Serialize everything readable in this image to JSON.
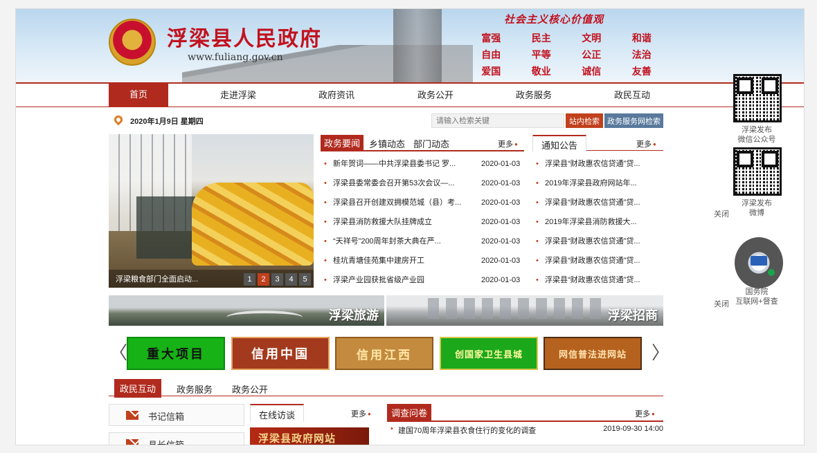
{
  "header": {
    "site_title": "浮梁县人民政府",
    "site_url": "www.fuliang.gov.cn",
    "values_title": "社会主义核心价值观",
    "values": [
      "富强",
      "民主",
      "文明",
      "和谐",
      "自由",
      "平等",
      "公正",
      "法治",
      "爱国",
      "敬业",
      "诚信",
      "友善"
    ]
  },
  "nav": {
    "items": [
      "首页",
      "走进浮梁",
      "政府资讯",
      "政务公开",
      "政务服务",
      "政民互动"
    ],
    "active": "首页"
  },
  "toolbar": {
    "date": "2020年1月9日 星期四",
    "search_placeholder": "请输入检索关键",
    "site_search_label": "站内检索",
    "gov_search_label": "政务服务网检索"
  },
  "slideshow": {
    "caption": "浮梁粮食部门全面启动...",
    "pages": [
      "1",
      "2",
      "3",
      "4",
      "5"
    ],
    "active_page": "2"
  },
  "news": {
    "tabs": [
      "政务要闻",
      "乡镇动态",
      "部门动态"
    ],
    "active_tab": "政务要闻",
    "more": "更多",
    "items": [
      {
        "title": "新年贺词——中共浮梁县委书记 罗...",
        "date": "2020-01-03"
      },
      {
        "title": "浮梁县委常委会召开第53次会议—...",
        "date": "2020-01-03"
      },
      {
        "title": "浮梁县召开创建双拥模范城（县）考...",
        "date": "2020-01-03"
      },
      {
        "title": "浮梁县消防救援大队挂牌成立",
        "date": "2020-01-03"
      },
      {
        "title": "“天祥号”200周年封茶大典在严...",
        "date": "2020-01-03"
      },
      {
        "title": "桂坑青塘佳苑集中建房开工",
        "date": "2020-01-03"
      },
      {
        "title": "浮梁产业园获批省级产业园",
        "date": "2020-01-03"
      }
    ]
  },
  "notice": {
    "tab": "通知公告",
    "more": "更多",
    "items": [
      "浮梁县“财政惠农信贷通”贷...",
      "2019年浮梁县政府网站年...",
      "浮梁县“财政惠农信贷通”贷...",
      "2019年浮梁县消防救援大...",
      "浮梁县“财政惠农信贷通”贷...",
      "浮梁县“财政惠农信贷通”贷...",
      "浮梁县“财政惠农信贷通”贷..."
    ]
  },
  "promos": {
    "tourism": "浮梁旅游",
    "investment": "浮梁招商"
  },
  "carousel": {
    "prev": "〈",
    "next": "〉",
    "items": [
      "重大项目",
      "信用中国",
      "信用江西",
      "创国家卫生县城",
      "网信普法进网站"
    ]
  },
  "bottom": {
    "tabs": [
      "政民互动",
      "政务服务",
      "政务公开"
    ],
    "active_tab": "政民互动",
    "mailboxes": [
      "书记信箱",
      "县长信箱"
    ],
    "interview": {
      "tab": "在线访谈",
      "more": "更多",
      "image_text": "浮梁县政府网站"
    },
    "survey": {
      "tab": "调查问卷",
      "more": "更多",
      "item_title": "建国70周年浮梁县衣食住行的变化的调查",
      "item_date": "2019-09-30 14:00"
    }
  },
  "side": {
    "wechat_label": "浮梁发布\n微信公众号",
    "weibo_label": "浮梁发布\n微博",
    "close": "关闭",
    "gov_label": "国务院\n互联网+督查",
    "close2": "关闭"
  },
  "colors": {
    "brand_red": "#b12a1e",
    "accent_orange": "#c1401e",
    "search_blue": "#58799c"
  }
}
